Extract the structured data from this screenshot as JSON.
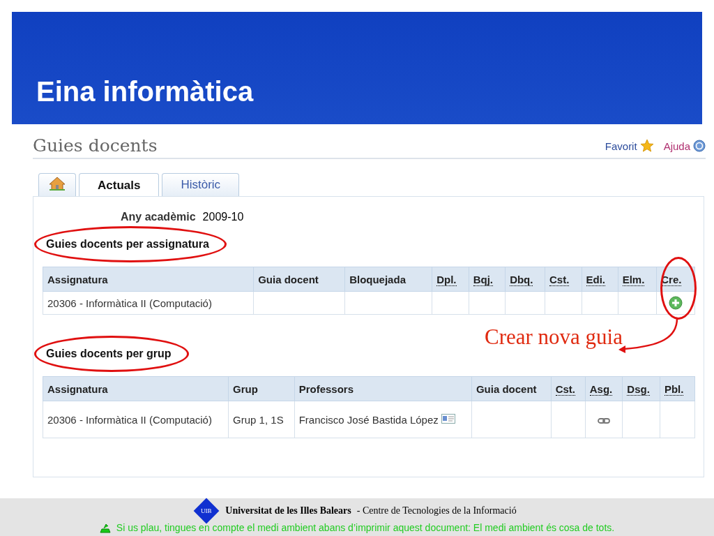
{
  "slide_title": "Eina informàtica",
  "page": {
    "title": "Guies docents",
    "links": [
      {
        "label": "Favorit",
        "kind": "favorite"
      },
      {
        "label": "Ajuda",
        "kind": "help"
      }
    ]
  },
  "tabs": [
    {
      "kind": "home",
      "selected": false
    },
    {
      "kind": "text",
      "label": "Actuals",
      "selected": true
    },
    {
      "kind": "text",
      "label": "Històric",
      "selected": false
    }
  ],
  "academic_year": {
    "label": "Any acadèmic",
    "value": "2009-10"
  },
  "subject_section": {
    "heading": "Guies docents per assignatura",
    "circled": true,
    "columns": [
      {
        "label": "Assignatura",
        "abbr": false
      },
      {
        "label": "Guia docent",
        "abbr": false
      },
      {
        "label": "Bloquejada",
        "abbr": false
      },
      {
        "label": "Dpl.",
        "abbr": true
      },
      {
        "label": "Bqj.",
        "abbr": true
      },
      {
        "label": "Dbq.",
        "abbr": true
      },
      {
        "label": "Cst.",
        "abbr": true
      },
      {
        "label": "Edi.",
        "abbr": true
      },
      {
        "label": "Elm.",
        "abbr": true
      },
      {
        "label": "Cre.",
        "abbr": true
      }
    ],
    "rows": [
      {
        "cells": [
          "20306 - Informàtica II (Computació)",
          "",
          "",
          "",
          "",
          "",
          "",
          "",
          "",
          ""
        ]
      }
    ]
  },
  "annotation": {
    "label": "Crear nova guia"
  },
  "group_section": {
    "heading": "Guies docents per grup",
    "circled": true,
    "columns": [
      {
        "label": "Assignatura",
        "abbr": false
      },
      {
        "label": "Grup",
        "abbr": false
      },
      {
        "label": "Professors",
        "abbr": false
      },
      {
        "label": "Guia docent",
        "abbr": false
      },
      {
        "label": "Cst.",
        "abbr": true
      },
      {
        "label": "Asg.",
        "abbr": true
      },
      {
        "label": "Dsg.",
        "abbr": true
      },
      {
        "label": "Pbl.",
        "abbr": true
      }
    ],
    "rows": [
      {
        "cells": [
          "20306 - Informàtica II (Computació)",
          "Grup 1, 1S",
          "Francisco José Bastida López",
          "",
          "",
          "",
          "",
          ""
        ]
      }
    ]
  },
  "footer": {
    "logo": "UIB",
    "university": "Universitat de les Illes Balears",
    "centre": "- Centre de Tecnologies de la Informació",
    "notice": "Si us plau, tingues en compte el medi ambient abans d’imprimir aquest document: El medi ambient és cosa de tots."
  }
}
